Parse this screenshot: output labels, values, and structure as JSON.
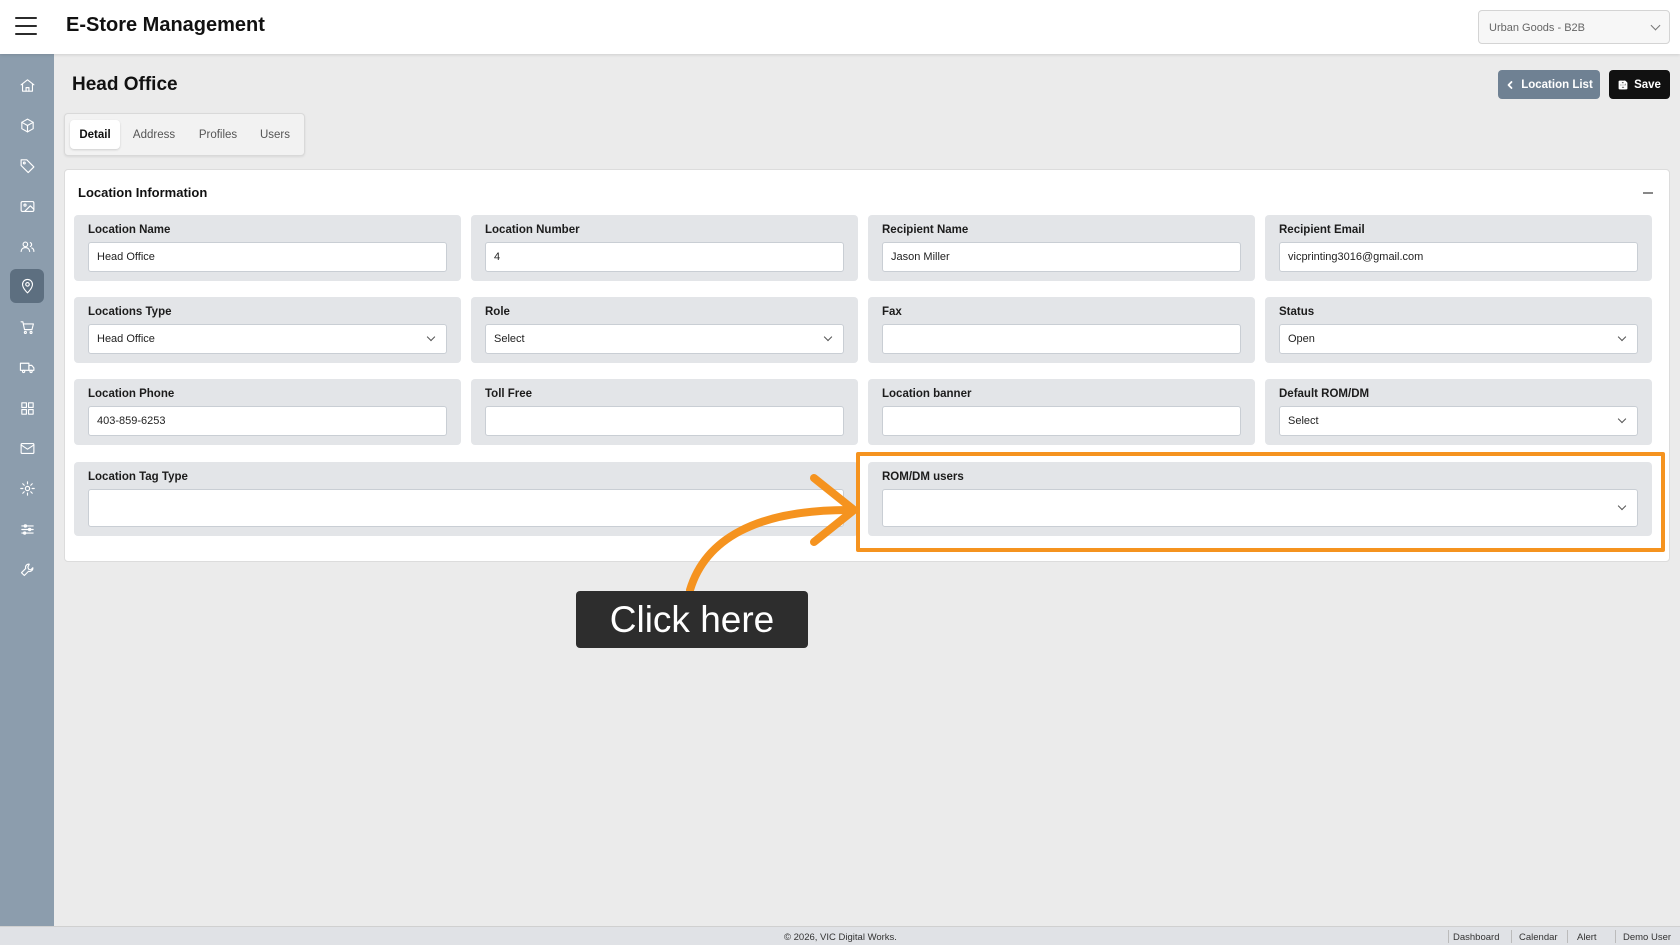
{
  "app": {
    "title": "E-Store Management",
    "store_select": "Urban Goods - B2B"
  },
  "sidebar": {
    "items": [
      {
        "icon": "home-icon",
        "label": "Home"
      },
      {
        "icon": "box-icon",
        "label": "Products"
      },
      {
        "icon": "tag-icon",
        "label": "Tags"
      },
      {
        "icon": "image-icon",
        "label": "Media"
      },
      {
        "icon": "users-icon",
        "label": "Customers"
      },
      {
        "icon": "location-pin-icon",
        "label": "Locations",
        "active": true
      },
      {
        "icon": "cart-icon",
        "label": "Orders"
      },
      {
        "icon": "truck-icon",
        "label": "Shipping"
      },
      {
        "icon": "grid-icon",
        "label": "Catalog"
      },
      {
        "icon": "mail-icon",
        "label": "Messages"
      },
      {
        "icon": "gear-icon",
        "label": "Settings"
      },
      {
        "icon": "sliders-icon",
        "label": "Configuration"
      },
      {
        "icon": "wrench-icon",
        "label": "Tools"
      }
    ]
  },
  "page": {
    "title": "Head Office",
    "location_list_label": "Location List",
    "save_label": "Save"
  },
  "tabs": [
    {
      "label": "Detail",
      "active": true
    },
    {
      "label": "Address"
    },
    {
      "label": "Profiles"
    },
    {
      "label": "Users"
    }
  ],
  "card": {
    "title": "Location Information"
  },
  "fields": {
    "location_name": {
      "label": "Location Name",
      "value": "Head Office"
    },
    "location_number": {
      "label": "Location Number",
      "value": "4"
    },
    "recipient_name": {
      "label": "Recipient Name",
      "value": "Jason Miller"
    },
    "recipient_email": {
      "label": "Recipient Email",
      "value": "vicprinting3016@gmail.com"
    },
    "locations_type": {
      "label": "Locations Type",
      "value": "Head Office"
    },
    "role": {
      "label": "Role",
      "value": "Select"
    },
    "fax": {
      "label": "Fax",
      "value": ""
    },
    "status": {
      "label": "Status",
      "value": "Open"
    },
    "location_phone": {
      "label": "Location Phone",
      "value": "403-859-6253"
    },
    "toll_free": {
      "label": "Toll Free",
      "value": ""
    },
    "location_banner": {
      "label": "Location banner",
      "value": ""
    },
    "default_rom_dm": {
      "label": "Default ROM/DM",
      "value": "Select"
    },
    "location_tag_type": {
      "label": "Location Tag Type",
      "value": ""
    },
    "rom_dm_users": {
      "label": "ROM/DM users",
      "value": ""
    }
  },
  "annotation": {
    "callout_text": "Click here",
    "color": "#f5931f"
  },
  "footer": {
    "copyright": "© 2026, VIC Digital Works.",
    "links": [
      "Dashboard",
      "Calendar",
      "Alert",
      "Demo User"
    ]
  }
}
